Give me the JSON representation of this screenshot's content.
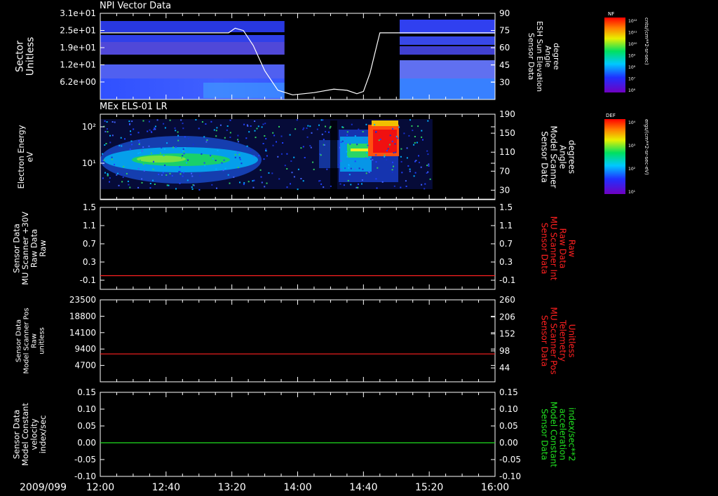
{
  "date_label": "2009/099",
  "x_axis": {
    "tick_labels": [
      "12:00",
      "12:40",
      "13:20",
      "14:00",
      "14:40",
      "15:20",
      "16:00"
    ],
    "range": [
      "12:00",
      "16:00"
    ]
  },
  "colorbars": [
    {
      "tag": "NF",
      "unit": "cnts/(cm**2-sr-sec)",
      "tick_labels": [
        "10¹²",
        "10¹¹",
        "10¹⁰",
        "10⁹",
        "10⁸",
        "10⁷",
        "10⁶"
      ]
    },
    {
      "tag": "DEF",
      "unit": "ergs/(cm**2-sr-sec-eV)",
      "tick_labels": [
        "10⁴",
        "10³",
        "10²",
        "10¹"
      ]
    }
  ],
  "colors": {
    "background": "#000000",
    "axis": "#ffffff",
    "red_trace": "#ff2020",
    "green_trace": "#20e020",
    "red_label": "#ff2020",
    "green_label": "#20e020"
  },
  "chart_data": [
    {
      "type": "heatmap",
      "title": "NPI Vector Data",
      "ylabel": [
        "Sector",
        "Unitless"
      ],
      "y_tick_labels": [
        "3.1e+01",
        "2.5e+01",
        "1.9e+01",
        "1.2e+01",
        "6.2e+00"
      ],
      "right_ylabel": [
        "Sensor Data",
        "ESH Sun Elevation",
        "Angle",
        "degree"
      ],
      "right_tick_labels": [
        "90",
        "75",
        "60",
        "45",
        "30"
      ],
      "right_ylim": [
        15,
        90
      ],
      "data_gap": [
        "13:52",
        "14:37"
      ],
      "overlay_line": {
        "name": "ESH Sun Elevation Angle",
        "x": [
          "12:00",
          "13:18",
          "13:22",
          "13:27",
          "13:33",
          "13:40",
          "13:48",
          "13:57",
          "14:10",
          "14:22",
          "14:30",
          "14:36",
          "14:40",
          "14:44",
          "14:50",
          "16:00"
        ],
        "y": [
          73,
          73,
          77,
          75,
          62,
          40,
          23,
          19,
          21,
          24,
          23,
          20,
          22,
          38,
          73,
          73
        ]
      }
    },
    {
      "type": "heatmap",
      "title": "MEx ELS-01 LR",
      "ylabel": [
        "Electron Energy",
        "eV"
      ],
      "y_tick_labels": [
        "10²",
        "10¹"
      ],
      "y_scale": "log",
      "right_ylabel": [
        "Sensor Data",
        "Model Scanner",
        "Angle",
        "degrees"
      ],
      "right_tick_labels": [
        "190",
        "150",
        "110",
        "70",
        "30"
      ],
      "right_ylim": [
        10,
        190
      ],
      "data_gap": [
        "15:22",
        "16:00"
      ],
      "overlay_line": {
        "name": "Model Scanner Angle",
        "x": [
          "12:00",
          "16:00"
        ],
        "y": [
          11,
          11
        ]
      }
    },
    {
      "type": "line",
      "ylabel": [
        "Sensor Data",
        "MU Scanner +30V",
        "Raw Data",
        "Raw"
      ],
      "y_tick_labels": [
        "1.5",
        "1.1",
        "0.7",
        "0.3",
        "-0.1"
      ],
      "ylim": [
        -0.3,
        1.5
      ],
      "right_ylabel": [
        "Sensor Data",
        "MU Scanner Int",
        "Raw Data",
        "Raw"
      ],
      "right_tick_labels": [
        "1.5",
        "1.1",
        "0.7",
        "0.3",
        "-0.1"
      ],
      "right_ylim": [
        -0.3,
        1.5
      ],
      "series": [
        {
          "name": "MU Scanner Int Raw Data",
          "x": [
            "12:00",
            "16:00"
          ],
          "y": [
            0.0,
            0.0
          ]
        }
      ]
    },
    {
      "type": "line",
      "ylabel": [
        "Sensor Data",
        "Model Scanner Pos",
        "Raw",
        "unitless"
      ],
      "y_tick_labels": [
        "23500",
        "18800",
        "14100",
        "9400",
        "4700"
      ],
      "ylim": [
        0,
        23500
      ],
      "right_ylabel": [
        "Sensor Data",
        "MU Scanner Pos",
        "Telemetry",
        "Unitless"
      ],
      "right_tick_labels": [
        "260",
        "206",
        "152",
        "98",
        "44"
      ],
      "right_ylim": [
        0,
        260
      ],
      "series": [
        {
          "name": "MU Scanner Pos Telemetry",
          "x": [
            "12:00",
            "16:00"
          ],
          "y": [
            8000,
            8000
          ]
        }
      ]
    },
    {
      "type": "line",
      "ylabel": [
        "Sensor Data",
        "Model Constant",
        "velocity",
        "index/sec"
      ],
      "y_tick_labels": [
        "0.15",
        "0.10",
        "0.05",
        "0.00",
        "-0.05",
        "-0.10"
      ],
      "ylim": [
        -0.1,
        0.15
      ],
      "right_ylabel": [
        "Sensor Data",
        "Model Constant",
        "acceleration",
        "index/sec**2"
      ],
      "right_tick_labels": [
        "0.15",
        "0.10",
        "0.05",
        "0.00",
        "-0.05",
        "-0.10"
      ],
      "right_ylim": [
        -0.1,
        0.15
      ],
      "series": [
        {
          "name": "Model Constant acceleration",
          "x": [
            "12:00",
            "16:00"
          ],
          "y": [
            0.0,
            0.0
          ]
        }
      ]
    }
  ]
}
